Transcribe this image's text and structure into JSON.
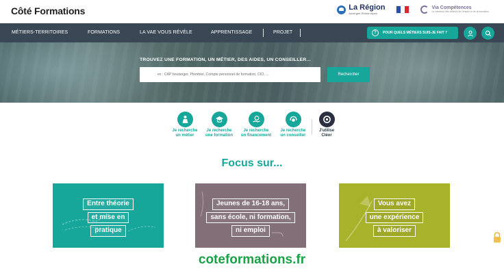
{
  "brand": {
    "logo_text": "Côté Formations"
  },
  "partners": {
    "region_name": "La Région",
    "region_sub": "Auvergne-Rhône-Alpes",
    "via_name": "Via Compétences",
    "via_sub": "Le carrefour des acteurs de l'emploi et de la formation"
  },
  "nav": {
    "items": [
      "MÉTIERS-TERRITOIRES",
      "FORMATIONS",
      "LA VAE VOUS RÉVÈLE",
      "APPRENTISSAGE",
      "PROJET"
    ],
    "cta_label": "POUR QUELS MÉTIERS SUIS-JE FAIT ?"
  },
  "hero": {
    "title": "TROUVEZ UNE FORMATION, UN MÉTIER, DES AIDES, UN CONSEILLER...",
    "search_placeholder": "ex : CAP boulanger, Plombier, Compte personnel de formation, CIO, ...",
    "search_button": "Rechercher"
  },
  "quick_actions": [
    {
      "line1": "Je recherche",
      "line2": "un métier"
    },
    {
      "line1": "Je recherche",
      "line2": "une formation"
    },
    {
      "line1": "Je recherche",
      "line2": "un financement"
    },
    {
      "line1": "Je recherche",
      "line2": "un conseiller"
    },
    {
      "line1": "J'utilise",
      "line2": "Cléor"
    }
  ],
  "focus": {
    "title": "Focus sur...",
    "cards": [
      {
        "lines": [
          "Entre théorie",
          "et mise en",
          "pratique"
        ]
      },
      {
        "lines": [
          "Jeunes de 16-18 ans,",
          "sans école, ni formation,",
          "ni emploi"
        ]
      },
      {
        "lines": [
          "Vous avez",
          "une expérience",
          "à valoriser"
        ]
      }
    ]
  },
  "caption": "coteformations.fr",
  "colors": {
    "teal": "#16a79a",
    "nav": "#3a4855",
    "mauve": "#826f78",
    "olive": "#a8b22a",
    "green_caption": "#19a246"
  }
}
